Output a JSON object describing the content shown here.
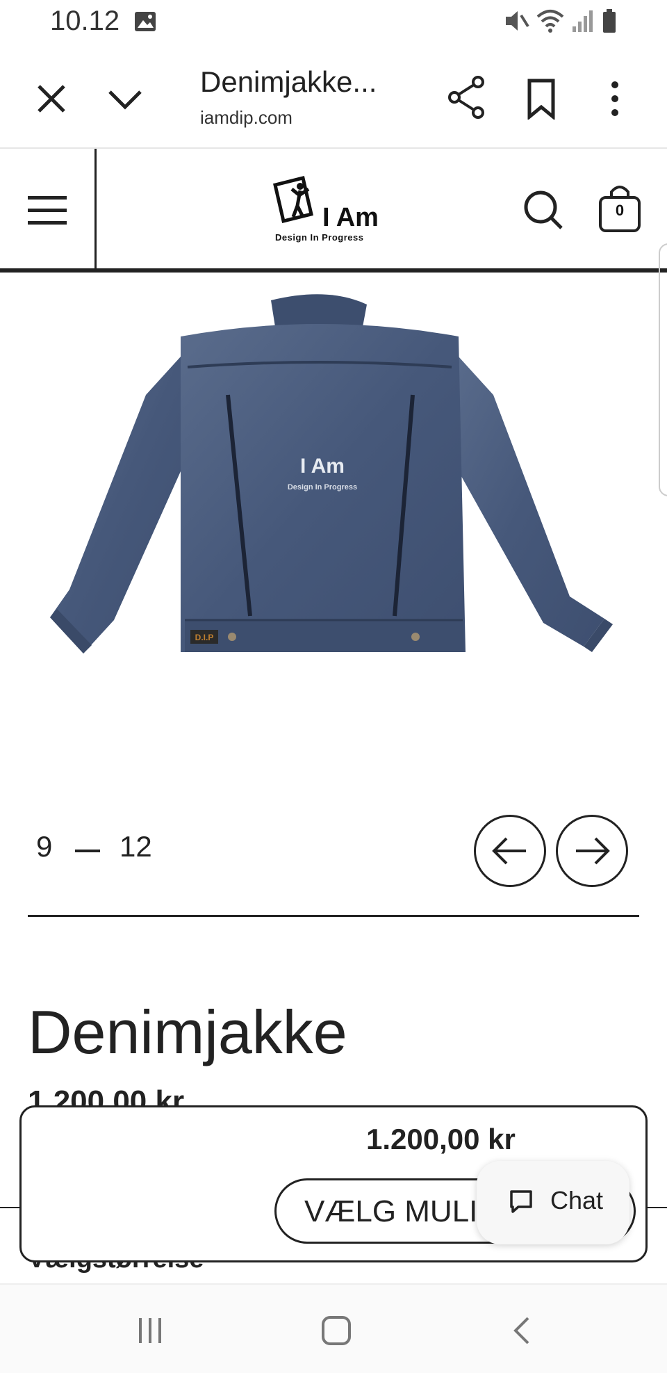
{
  "status_bar": {
    "time": "10.12",
    "icons": [
      "image-icon",
      "mute-icon",
      "wifi-icon",
      "signal-icon",
      "battery-icon"
    ]
  },
  "browser": {
    "title": "Denimjakke...",
    "domain": "iamdip.com",
    "icons": [
      "close-icon",
      "chevron-down-icon",
      "share-icon",
      "bookmark-icon",
      "more-vert-icon"
    ]
  },
  "site_header": {
    "logo_text": "I Am",
    "logo_subtext": "Design In Progress",
    "cart_count": "0"
  },
  "product_image": {
    "back_print_title": "I Am",
    "back_print_sub": "Design In Progress",
    "tab_label": "D.I.P"
  },
  "slider": {
    "current": "9",
    "total": "12"
  },
  "product": {
    "title": "Denimjakke",
    "price": "1.200,00 kr",
    "size_label": "Vælgstørrelse"
  },
  "sticky_bar": {
    "price": "1.200,00 kr",
    "choose_button": "VÆLG MULIGHEDER"
  },
  "chat": {
    "label": "Chat"
  },
  "colors": {
    "denim": "#4a5c7d",
    "text": "#222222",
    "chat_bg": "#f7f7f7"
  }
}
